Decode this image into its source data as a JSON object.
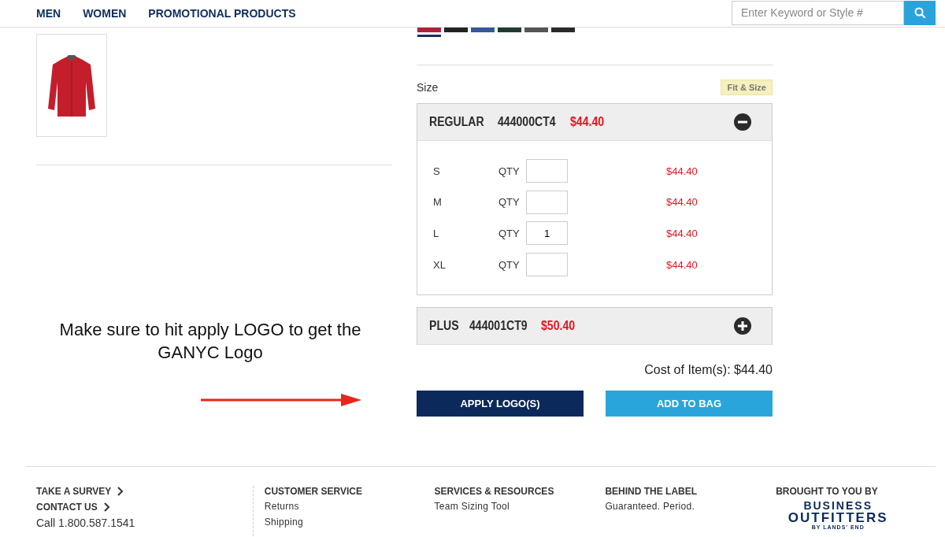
{
  "nav": {
    "links": [
      "MEN",
      "WOMEN",
      "PROMOTIONAL PRODUCTS"
    ],
    "search": {
      "placeholder": "Enter Keyword or Style #"
    }
  },
  "swatches": [
    {
      "color": "#b0203a",
      "selected": true
    },
    {
      "color": "#222222",
      "selected": false
    },
    {
      "color": "#34589a",
      "selected": false
    },
    {
      "color": "#1f3b33",
      "selected": false
    },
    {
      "color": "#555555",
      "selected": false
    },
    {
      "color": "#2a2a2a",
      "selected": false
    }
  ],
  "annotation": {
    "text": "Make sure to hit apply LOGO to get the GANYC Logo"
  },
  "size_label": "Size",
  "fit_button": "Fit & Size",
  "size_groups": [
    {
      "name": "REGULAR",
      "style": "444000CT4",
      "price": "$44.40",
      "expanded": true,
      "sizes": [
        {
          "size": "S",
          "qty_label": "QTY",
          "price": "$44.40"
        },
        {
          "size": "M",
          "qty_label": "QTY",
          "price": "$44.40"
        },
        {
          "size": "L",
          "qty_label": "QTY",
          "qty": "1",
          "price": "$44.40"
        },
        {
          "size": "XL",
          "qty_label": "QTY",
          "price": "$44.40"
        }
      ]
    },
    {
      "name": "PLUS",
      "style": "444001CT9",
      "price": "$50.40",
      "expanded": false
    }
  ],
  "cost": "Cost of Item(s): $44.40",
  "buttons": [
    {
      "label": "APPLY LOGO(S)",
      "kind": "primary"
    },
    {
      "label": "ADD TO BAG",
      "kind": "secondary"
    }
  ],
  "footer": {
    "columns": [
      {
        "items": [
          {
            "kind": "heading-link",
            "text": "TAKE A SURVEY"
          },
          {
            "kind": "heading-link",
            "text": "CONTACT US"
          },
          {
            "kind": "text",
            "text": "Call 1.800.587.1541"
          }
        ]
      },
      {
        "heading": "CUSTOMER SERVICE",
        "items": [
          {
            "kind": "link",
            "text": "Returns"
          },
          {
            "kind": "link",
            "text": "Shipping"
          }
        ]
      },
      {
        "heading": "SERVICES & RESOURCES",
        "items": [
          {
            "kind": "link",
            "text": "Team Sizing Tool"
          }
        ]
      },
      {
        "heading": "BEHIND THE LABEL",
        "items": [
          {
            "kind": "link",
            "text": "Guaranteed. Period."
          }
        ]
      },
      {
        "heading": "BROUGHT TO YOU BY",
        "logo": [
          "BUSINESS",
          "OUTFITTERS",
          "BY LANDS' END"
        ]
      }
    ]
  }
}
